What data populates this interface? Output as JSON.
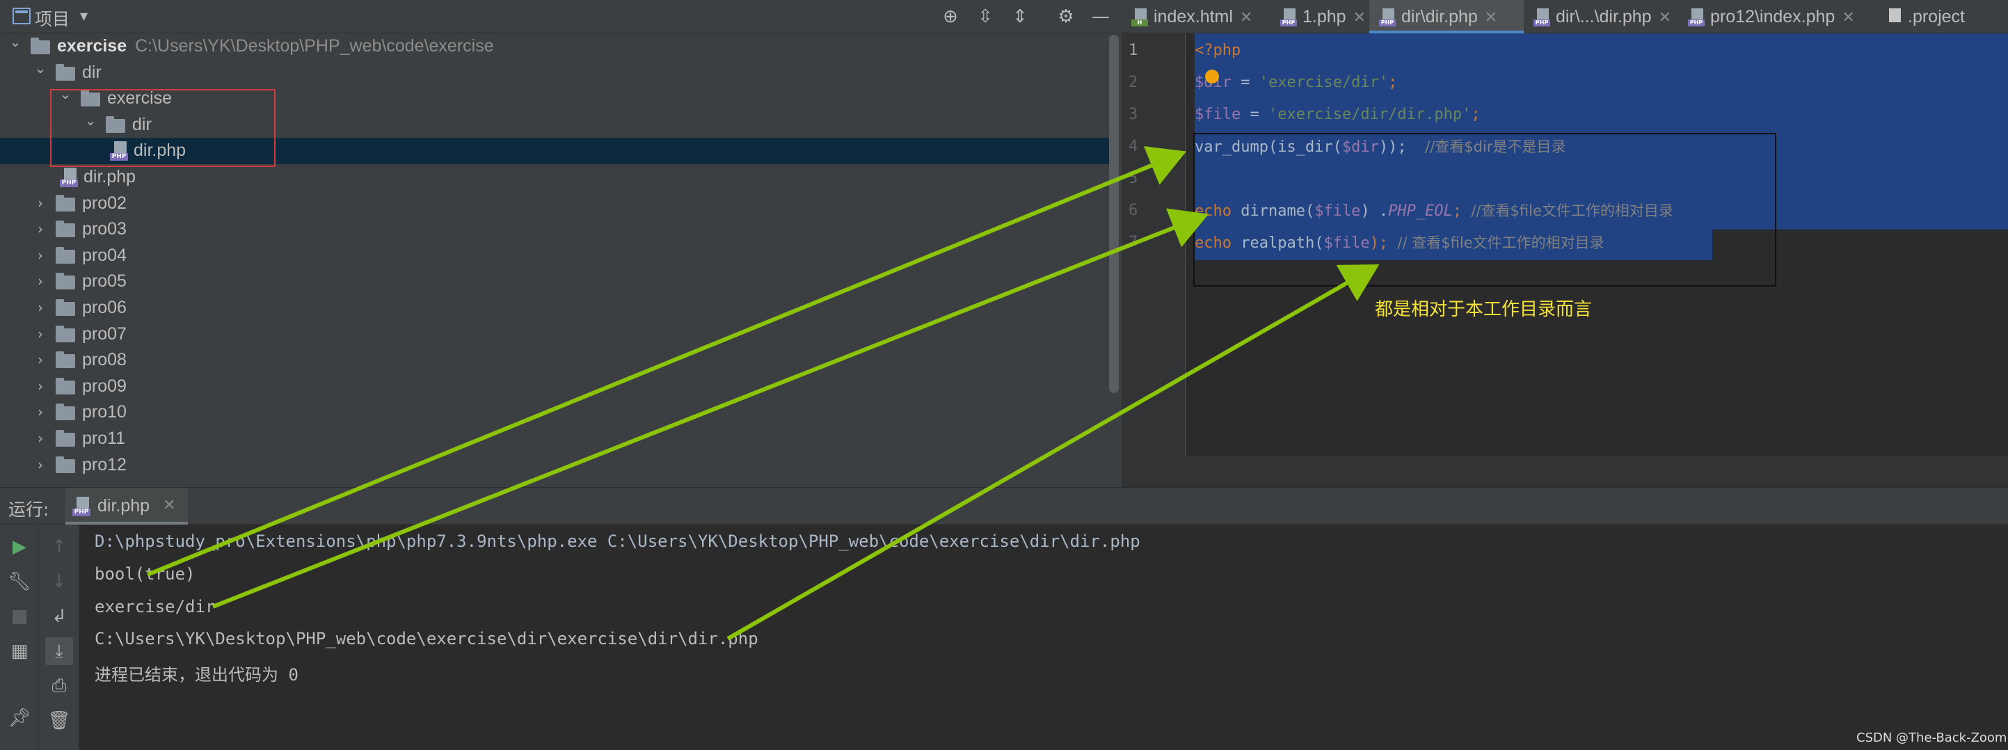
{
  "project_pane": {
    "title": "项目",
    "tree": [
      {
        "label": "exercise",
        "path": "C:\\Users\\YK\\Desktop\\PHP_web\\code\\exercise",
        "type": "folder",
        "depth": 0,
        "expanded": true
      },
      {
        "label": "dir",
        "type": "folder",
        "depth": 1,
        "expanded": true
      },
      {
        "label": "exercise",
        "type": "folder",
        "depth": 2,
        "expanded": true
      },
      {
        "label": "dir",
        "type": "folder",
        "depth": 3,
        "expanded": true
      },
      {
        "label": "dir.php",
        "type": "php",
        "depth": 4,
        "selected": true
      },
      {
        "label": "dir.php",
        "type": "php",
        "depth": 2
      },
      {
        "label": "pro02",
        "type": "folder",
        "depth": 1
      },
      {
        "label": "pro03",
        "type": "folder",
        "depth": 1
      },
      {
        "label": "pro04",
        "type": "folder",
        "depth": 1
      },
      {
        "label": "pro05",
        "type": "folder",
        "depth": 1
      },
      {
        "label": "pro06",
        "type": "folder",
        "depth": 1
      },
      {
        "label": "pro07",
        "type": "folder",
        "depth": 1
      },
      {
        "label": "pro08",
        "type": "folder",
        "depth": 1
      },
      {
        "label": "pro09",
        "type": "folder",
        "depth": 1
      },
      {
        "label": "pro10",
        "type": "folder",
        "depth": 1
      },
      {
        "label": "pro11",
        "type": "folder",
        "depth": 1
      },
      {
        "label": "pro12",
        "type": "folder",
        "depth": 1
      }
    ]
  },
  "editor": {
    "tabs": [
      {
        "label": "index.html",
        "icon": "html-file-icon",
        "active": false
      },
      {
        "label": "1.php",
        "icon": "php-file-icon",
        "active": false
      },
      {
        "label": "dir\\dir.php",
        "icon": "php-file-icon",
        "active": true
      },
      {
        "label": "dir\\...\\dir.php",
        "icon": "php-file-icon",
        "active": false
      },
      {
        "label": "pro12\\index.php",
        "icon": "php-file-icon",
        "active": false
      },
      {
        "label": ".project",
        "icon": "file-icon",
        "active": false
      }
    ],
    "line_numbers": [
      "1",
      "2",
      "3",
      "4",
      "5",
      "6",
      "7"
    ],
    "code": {
      "l1": "<?php",
      "l2_var": "$dir",
      "l2_eq": " = ",
      "l2_str": "'exercise/dir'",
      "l2_end": ";",
      "l3_var": "$file",
      "l3_eq": " = ",
      "l3_str": "'exercise/dir/dir.php'",
      "l3_end": ";",
      "l4_fn": "var_dump(is_dir(",
      "l4_var": "$dir",
      "l4_end": "));  ",
      "l4_cmt": "//查看$dir是不是目录",
      "l6_kw": "echo",
      "l6_fn": " dirname(",
      "l6_var": "$file",
      "l6_mid": ") .",
      "l6_const": "PHP_EOL",
      "l6_end": "; ",
      "l6_cmt": "//查看$file文件工作的相对目录",
      "l7_kw": "echo",
      "l7_fn": " realpath(",
      "l7_var": "$file",
      "l7_end": "); ",
      "l7_cmt": "// 查看$file文件工作的相对目录"
    },
    "annotation": "都是相对于本工作目录而言"
  },
  "run_pane": {
    "label": "运行:",
    "tab": "dir.php",
    "output": [
      "D:\\phpstudy_pro\\Extensions\\php\\php7.3.9nts\\php.exe C:\\Users\\YK\\Desktop\\PHP_web\\code\\exercise\\dir\\dir.php",
      "bool(true)",
      "exercise/dir",
      "C:\\Users\\YK\\Desktop\\PHP_web\\code\\exercise\\dir\\exercise\\dir\\dir.php",
      "进程已结束，退出代码为 0"
    ]
  },
  "watermark": "CSDN @The-Back-Zoom",
  "colors": {
    "annotation_arrow": "#8bc408",
    "highlight_box": "#d13b3b",
    "selection": "#214283"
  }
}
